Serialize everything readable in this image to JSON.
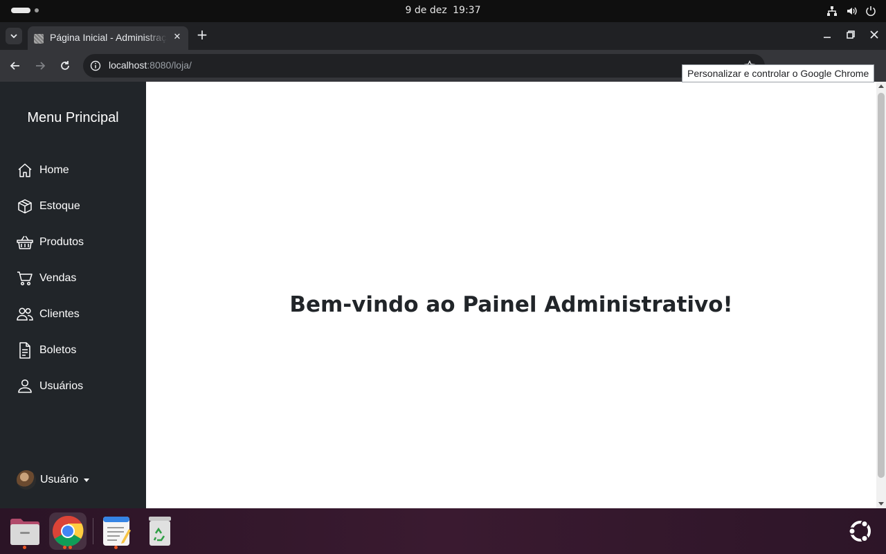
{
  "system": {
    "date": "9 de dez",
    "time": "19:37"
  },
  "browser": {
    "tab_title": "Página Inicial - Administração",
    "tab_close": "✕",
    "new_tab": "+",
    "url_host": "localhost",
    "url_rest": ":8080/loja/",
    "tooltip": "Personalizar e controlar o Google Chrome"
  },
  "sidebar": {
    "title": "Menu Principal",
    "items": [
      {
        "label": "Home",
        "icon": "house-icon"
      },
      {
        "label": "Estoque",
        "icon": "box-icon"
      },
      {
        "label": "Produtos",
        "icon": "basket-icon"
      },
      {
        "label": "Vendas",
        "icon": "cart-icon"
      },
      {
        "label": "Clientes",
        "icon": "people-icon"
      },
      {
        "label": "Boletos",
        "icon": "document-icon"
      },
      {
        "label": "Usuários",
        "icon": "person-icon"
      }
    ],
    "user_label": "Usuário"
  },
  "main": {
    "welcome": "Bem-vindo ao Painel Administrativo!"
  },
  "dock": {
    "apps": [
      "files-icon",
      "chrome-icon",
      "text-editor-icon",
      "trash-icon"
    ]
  },
  "colors": {
    "sidebar_bg": "#212529",
    "main_bg": "#ffffff",
    "heading": "#212529",
    "chrome_toolbar": "#35363a",
    "ubuntu_accent": "#e95420"
  }
}
